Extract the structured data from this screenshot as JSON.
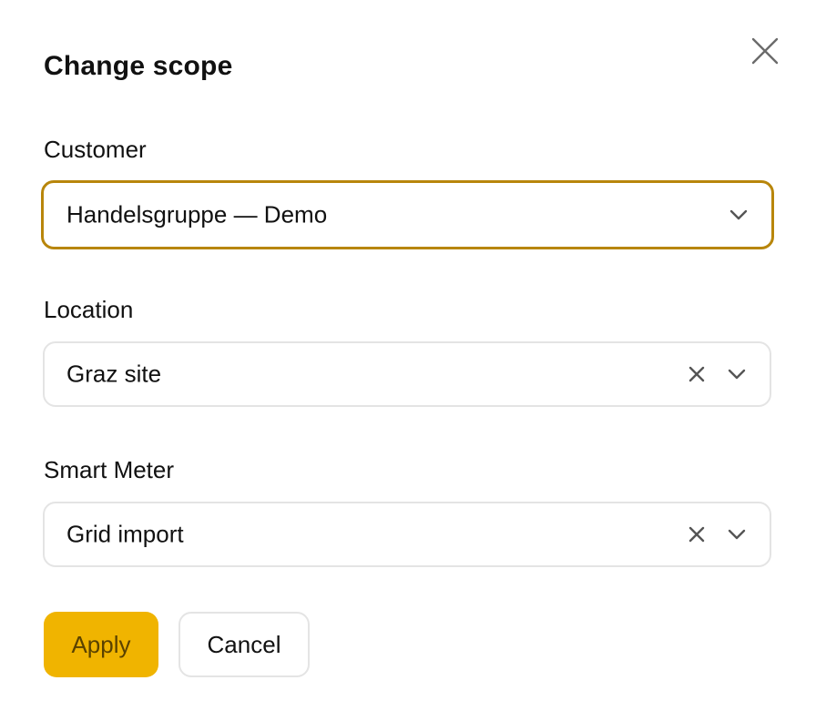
{
  "dialog": {
    "title": "Change scope"
  },
  "fields": {
    "customer": {
      "label": "Customer",
      "value": "Handelsgruppe — Demo"
    },
    "location": {
      "label": "Location",
      "value": "Graz site"
    },
    "smart_meter": {
      "label": "Smart Meter",
      "value": "Grid import"
    }
  },
  "actions": {
    "apply_label": "Apply",
    "cancel_label": "Cancel"
  },
  "icons": {
    "close": "close-icon",
    "chevron": "chevron-down-icon",
    "clear": "clear-icon"
  },
  "colors": {
    "accent": "#f0b400",
    "focus_border": "#b8860b",
    "apply_text": "#5a4200"
  }
}
